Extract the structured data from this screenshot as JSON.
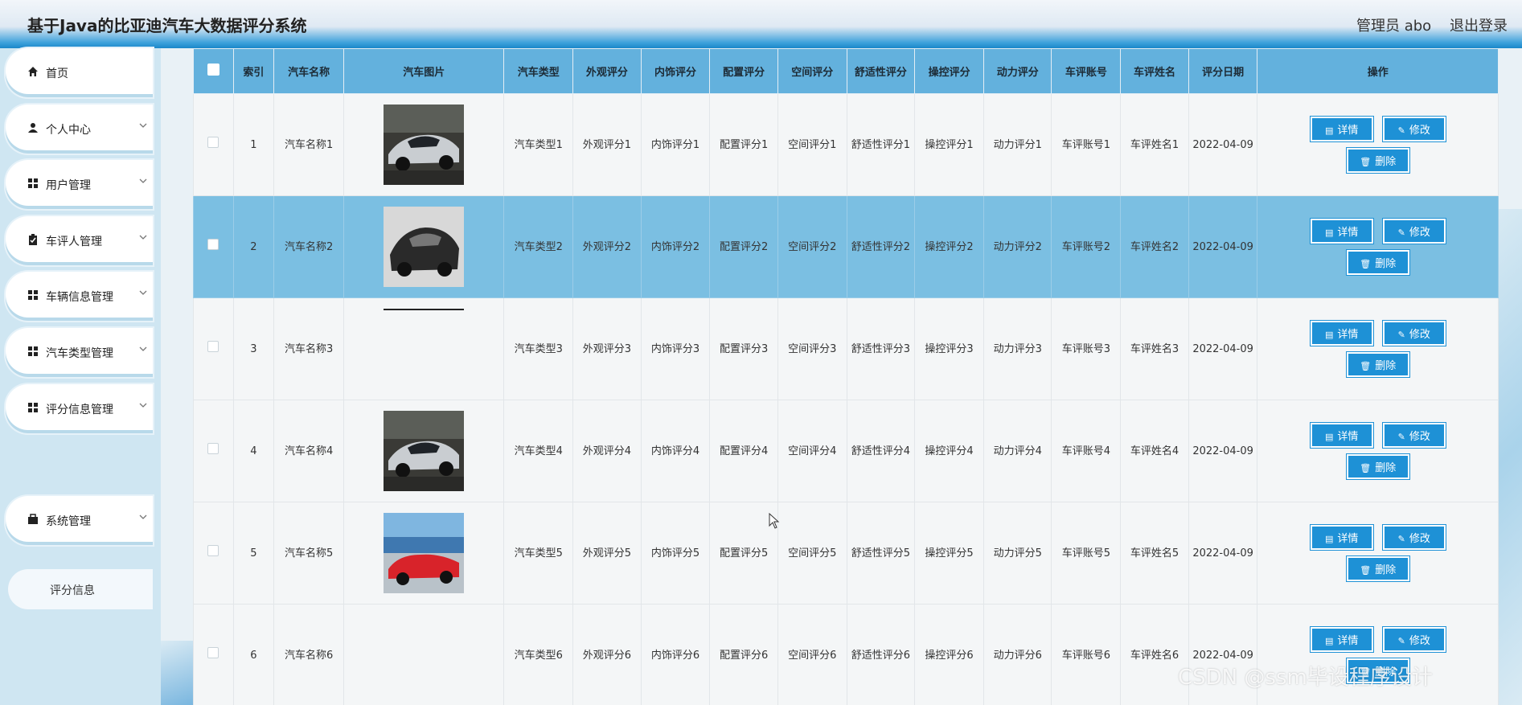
{
  "header": {
    "title": "基于Java的比亚迪汽车大数据评分系统",
    "user_label": "管理员 abo",
    "logout": "退出登录"
  },
  "sidebar": {
    "items": [
      {
        "label": "首页",
        "icon": "home-icon",
        "has_arrow": false
      },
      {
        "label": "个人中心",
        "icon": "user-icon",
        "has_arrow": true
      },
      {
        "label": "用户管理",
        "icon": "grid-icon",
        "has_arrow": true
      },
      {
        "label": "车评人管理",
        "icon": "clipboard-icon",
        "has_arrow": true
      },
      {
        "label": "车辆信息管理",
        "icon": "grid-icon",
        "has_arrow": true
      },
      {
        "label": "汽车类型管理",
        "icon": "grid-icon",
        "has_arrow": true
      },
      {
        "label": "评分信息管理",
        "icon": "grid-icon",
        "has_arrow": true
      },
      {
        "label": "系统管理",
        "icon": "briefcase-icon",
        "has_arrow": true
      }
    ],
    "sub_item": "评分信息"
  },
  "table": {
    "headers": [
      "索引",
      "汽车名称",
      "汽车图片",
      "汽车类型",
      "外观评分",
      "内饰评分",
      "配置评分",
      "空间评分",
      "舒适性评分",
      "操控评分",
      "动力评分",
      "车评账号",
      "车评姓名",
      "评分日期",
      "操作"
    ],
    "rows": [
      {
        "index": "1",
        "name": "汽车名称1",
        "image": "silver-sports-car",
        "type": "汽车类型1",
        "exterior": "外观评分1",
        "interior": "内饰评分1",
        "config": "配置评分1",
        "space": "空间评分1",
        "comfort": "舒适性评分1",
        "handling": "操控评分1",
        "power": "动力评分1",
        "account": "车评账号1",
        "reviewer": "车评姓名1",
        "date": "2022-04-09"
      },
      {
        "index": "2",
        "name": "汽车名称2",
        "image": "black-sports-car",
        "type": "汽车类型2",
        "exterior": "外观评分2",
        "interior": "内饰评分2",
        "config": "配置评分2",
        "space": "空间评分2",
        "comfort": "舒适性评分2",
        "handling": "操控评分2",
        "power": "动力评分2",
        "account": "车评账号2",
        "reviewer": "车评姓名2",
        "date": "2022-04-09"
      },
      {
        "index": "3",
        "name": "汽车名称3",
        "image": "",
        "type": "汽车类型3",
        "exterior": "外观评分3",
        "interior": "内饰评分3",
        "config": "配置评分3",
        "space": "空间评分3",
        "comfort": "舒适性评分3",
        "handling": "操控评分3",
        "power": "动力评分3",
        "account": "车评账号3",
        "reviewer": "车评姓名3",
        "date": "2022-04-09"
      },
      {
        "index": "4",
        "name": "汽车名称4",
        "image": "silver-sports-car",
        "type": "汽车类型4",
        "exterior": "外观评分4",
        "interior": "内饰评分4",
        "config": "配置评分4",
        "space": "空间评分4",
        "comfort": "舒适性评分4",
        "handling": "操控评分4",
        "power": "动力评分4",
        "account": "车评账号4",
        "reviewer": "车评姓名4",
        "date": "2022-04-09"
      },
      {
        "index": "5",
        "name": "汽车名称5",
        "image": "red-convertible",
        "type": "汽车类型5",
        "exterior": "外观评分5",
        "interior": "内饰评分5",
        "config": "配置评分5",
        "space": "空间评分5",
        "comfort": "舒适性评分5",
        "handling": "操控评分5",
        "power": "动力评分5",
        "account": "车评账号5",
        "reviewer": "车评姓名5",
        "date": "2022-04-09"
      },
      {
        "index": "6",
        "name": "汽车名称6",
        "image": "",
        "type": "汽车类型6",
        "exterior": "外观评分6",
        "interior": "内饰评分6",
        "config": "配置评分6",
        "space": "空间评分6",
        "comfort": "舒适性评分6",
        "handling": "操控评分6",
        "power": "动力评分6",
        "account": "车评账号6",
        "reviewer": "车评姓名6",
        "date": "2022-04-09"
      }
    ],
    "selected_row": 2,
    "actions": {
      "detail": "详情",
      "edit": "修改",
      "delete": "删除"
    }
  },
  "watermark": "CSDN @ssm毕设程序设计",
  "colors": {
    "accent": "#1e91d6",
    "header_row": "#63b1dd",
    "selected_row": "#7bbfe2"
  }
}
